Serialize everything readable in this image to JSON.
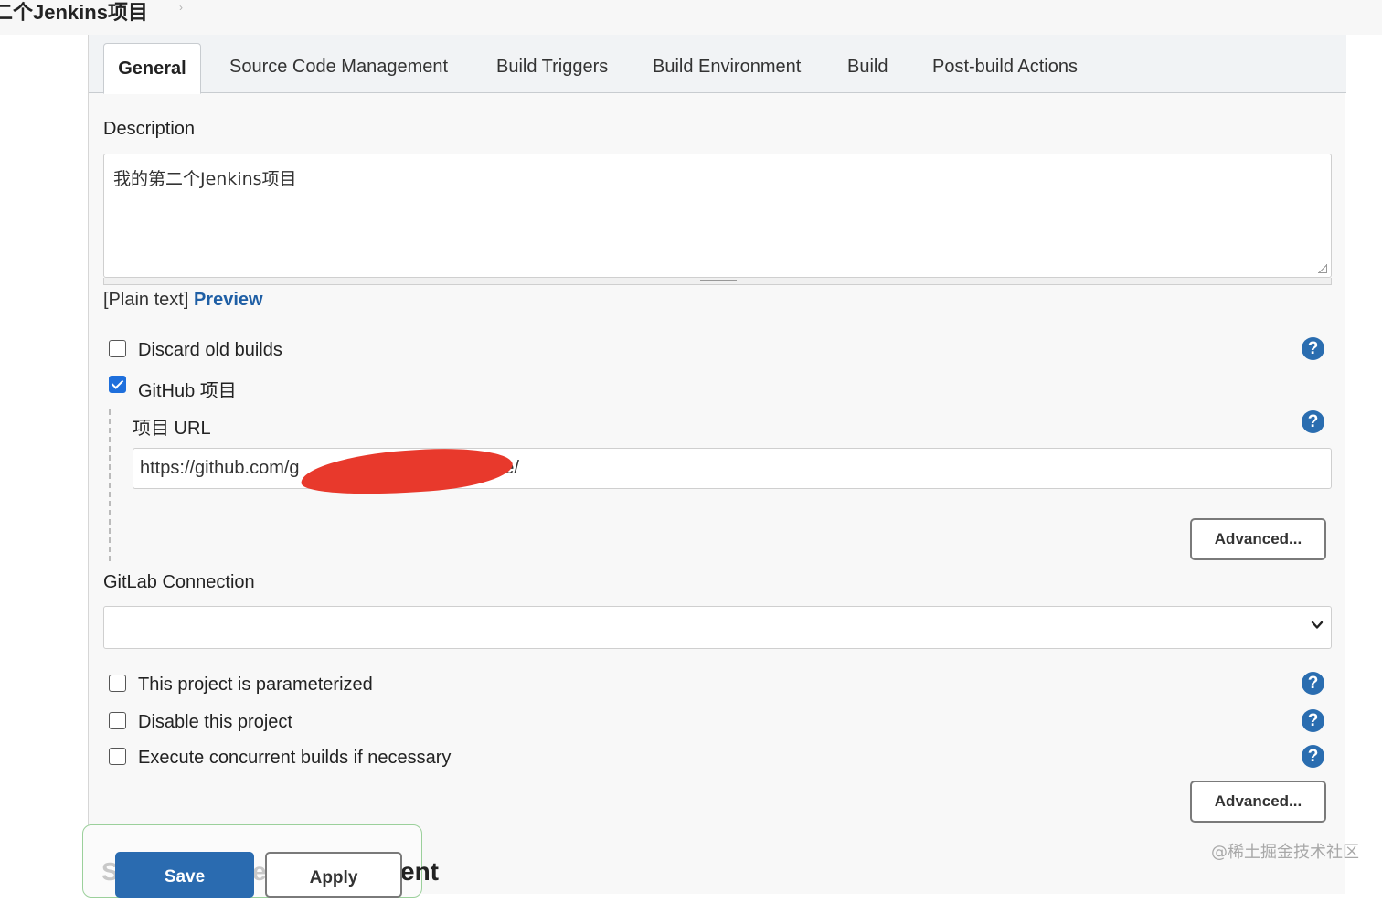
{
  "breadcrumb": {
    "title": "二个Jenkins项目",
    "arrow": "›"
  },
  "tabs": [
    {
      "label": "General",
      "active": true
    },
    {
      "label": "Source Code Management"
    },
    {
      "label": "Build Triggers"
    },
    {
      "label": "Build Environment"
    },
    {
      "label": "Build"
    },
    {
      "label": "Post-build Actions"
    }
  ],
  "description": {
    "label": "Description",
    "value": "我的第二个Jenkins项目",
    "plain_text": "[Plain text]",
    "preview_link": "Preview"
  },
  "options": {
    "discard_old_builds": {
      "label": "Discard old builds",
      "checked": false
    },
    "github_project": {
      "label": "GitHub 项目",
      "checked": true
    },
    "parameterized": {
      "label": "This project is parameterized",
      "checked": false
    },
    "disable_project": {
      "label": "Disable this project",
      "checked": false
    },
    "concurrent_builds": {
      "label": "Execute concurrent builds if necessary",
      "checked": false
    }
  },
  "project_url": {
    "label": "项目 URL",
    "value_prefix": "https://github.com/g",
    "value_suffix": "ate/"
  },
  "advanced_label": "Advanced...",
  "gitlab": {
    "label": "GitLab Connection",
    "selected": ""
  },
  "help_glyph": "?",
  "footer": {
    "save_label": "Save",
    "apply_label": "Apply",
    "behind_left": "S",
    "behind_mid": "e",
    "behind_right": "ent"
  },
  "watermark": "@稀土掘金技术社区",
  "colors": {
    "accent": "#2a6bb0",
    "link": "#1f5fa5",
    "redaction": "#e8392c",
    "check": "#1e6fdc"
  }
}
